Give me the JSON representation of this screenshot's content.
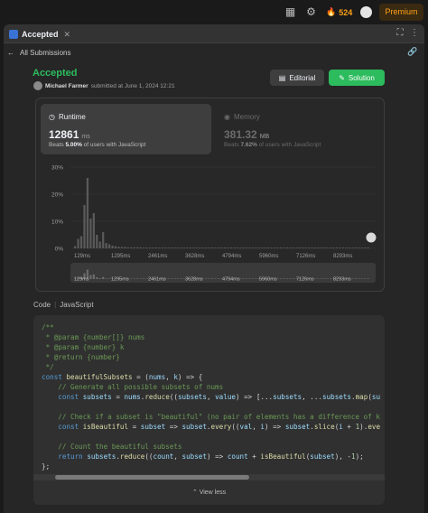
{
  "topbar": {
    "streak_count": "524",
    "premium_label": "Premium",
    "icons": [
      "layout-icon",
      "gear-icon",
      "fire-icon",
      "user-avatar"
    ]
  },
  "tab": {
    "title": "Accepted"
  },
  "nav": {
    "back_label": "All Submissions"
  },
  "submission": {
    "status": "Accepted",
    "author": "Michael Farmer",
    "submitted_text": "submitted at June 1, 2024 12:21",
    "editorial_label": "Editorial",
    "solution_label": "Solution"
  },
  "runtime": {
    "label": "Runtime",
    "value": "12861",
    "unit": "ms",
    "beats_prefix": "Beats",
    "beats_pct": "5.00%",
    "beats_suffix": "of users with JavaScript"
  },
  "memory": {
    "label": "Memory",
    "value": "381.32",
    "unit": "MB",
    "beats_prefix": "Beats",
    "beats_pct": "7.62%",
    "beats_suffix": "of users with JavaScript"
  },
  "chart_data": {
    "type": "bar",
    "y_ticks": [
      "30%",
      "20%",
      "10%",
      "0%"
    ],
    "ylim": [
      0,
      30
    ],
    "x_ticks": [
      "129ms",
      "1295ms",
      "2461ms",
      "3628ms",
      "4794ms",
      "5960ms",
      "7126ms",
      "8293ms"
    ],
    "values": [
      0.8,
      3.5,
      4.5,
      16,
      26,
      11,
      13,
      5,
      2.5,
      6,
      2,
      1.5,
      1,
      0.8,
      0.6,
      0.5,
      0.5,
      0.4,
      0.4,
      0.4,
      0.4,
      0.4,
      0.3,
      0.3,
      0.3,
      0.3,
      0.3,
      0.3,
      0.3,
      0.3,
      0.3,
      0.3,
      0.3,
      0.3,
      0.3,
      0.3,
      0.3,
      0.3,
      0.3,
      0.3,
      0.3,
      0.3,
      0.3,
      0.3,
      0.3,
      0.3,
      0.3,
      0.3,
      0.3,
      0.3,
      0.3,
      0.3,
      0.3,
      0.3,
      0.3,
      0.3,
      0.3,
      0.3,
      0.3,
      0.3,
      0.3,
      0.3,
      0.3,
      0.3,
      0.3,
      0.3,
      0.3,
      0.3,
      0.3,
      0.3,
      0.3,
      0.3,
      0.3,
      0.3,
      0.3,
      0.3,
      0.3,
      0.3,
      0.3,
      0.3,
      0.3,
      0.3,
      0.3,
      0.3,
      0.3,
      0.3,
      0.3,
      0.3,
      0.3,
      0.3,
      0.3,
      0.3,
      0.3,
      0.3,
      0.3
    ],
    "user_marker_x": "12861ms",
    "bar_color": "#5a5a5a",
    "grid": true
  },
  "code": {
    "language_label": "Code",
    "language": "JavaScript",
    "view_less_label": "View less"
  }
}
